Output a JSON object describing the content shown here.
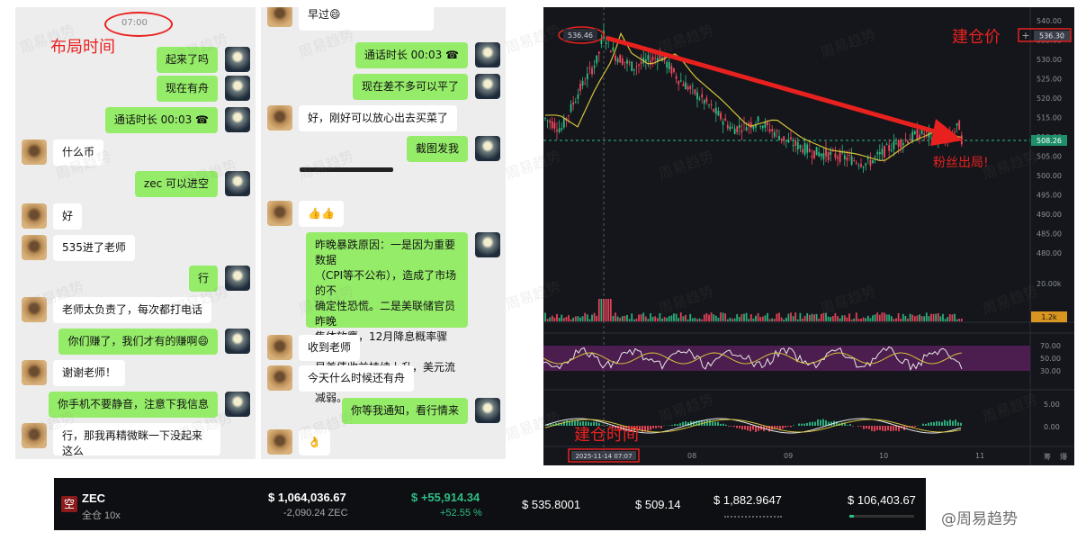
{
  "left_chat": {
    "time": "07:00",
    "annotation": "布局时间",
    "messages": [
      {
        "side": "self",
        "text": "起来了吗"
      },
      {
        "side": "self",
        "text": "现在有舟"
      },
      {
        "side": "self",
        "text": "通话时长 00:03 ☎"
      },
      {
        "side": "other",
        "text": "什么币"
      },
      {
        "side": "self",
        "text": "zec 可以进空"
      },
      {
        "side": "other",
        "text": "好"
      },
      {
        "side": "other",
        "text": "535进了老师"
      },
      {
        "side": "self",
        "text": "行"
      },
      {
        "side": "other",
        "text": "老师太负责了，每次都打电话"
      },
      {
        "side": "self",
        "text": "你们赚了，我们才有的赚啊😄"
      },
      {
        "side": "other",
        "text": "谢谢老师！"
      },
      {
        "side": "self",
        "text": "你手机不要静音，注意下我信息"
      },
      {
        "side": "other",
        "text": "行，那我再精微眯一下没起来这么\n早过😄"
      }
    ]
  },
  "right_chat": {
    "messages": [
      {
        "side": "other",
        "text": "早过😄"
      },
      {
        "side": "self",
        "text": "通话时长 00:03 ☎"
      },
      {
        "side": "self",
        "text": "现在差不多可以平了"
      },
      {
        "side": "other",
        "text": "好，刚好可以放心出去买菜了"
      },
      {
        "side": "self",
        "text": "截图发我"
      },
      {
        "side": "other",
        "text": "👍👍"
      },
      {
        "side": "self",
        "text": "昨晚暴跌原因：一是因为重要数据\n（CPI等不公布），造成了市场的不\n确定性恐慌。二是美联储官员昨晚\n集体放鹰，12月降息概率骤降。三\n是美债收益持续上升，美元流动性\n减弱。"
      },
      {
        "side": "other",
        "text": "收到老师"
      },
      {
        "side": "other",
        "text": "今天什么时候还有舟"
      },
      {
        "side": "self",
        "text": "你等我通知，看行情来"
      },
      {
        "side": "other",
        "text": "👌"
      }
    ]
  },
  "chart": {
    "entry_label": "建仓价",
    "entry_price": "536.30",
    "peak_label": "536.46",
    "current_price": "508.26",
    "volume_label": "1.2k",
    "exit_note": "粉丝出局!",
    "time_note": "建仓时间",
    "entry_time": "2025-11-14 07:07",
    "price_ticks": [
      "540.00",
      "535.00",
      "530.00",
      "525.00",
      "520.00",
      "515.00",
      "510.00",
      "505.00",
      "500.00",
      "495.00",
      "490.00",
      "485.00",
      "480.00"
    ],
    "volume_tick": "20.00k",
    "rsi_ticks": [
      "70.00",
      "50.00",
      "30.00"
    ],
    "macd_ticks": [
      "5.00",
      "0.00"
    ],
    "x_ticks": [
      "08",
      "09",
      "10",
      "11"
    ],
    "corner_labels": [
      "筹",
      "爆"
    ],
    "colors": {
      "up": "#2ebd85",
      "down": "#f6465d",
      "ma": "#d4c23a",
      "rsi_band": "#5a1f5c",
      "arrow": "#e8211f"
    }
  },
  "position": {
    "side_badge": "空",
    "symbol": "ZEC",
    "margin": "全仓 10x",
    "value": "$ 1,064,036.67",
    "size": "-2,090.24 ZEC",
    "pnl": "$ +55,914.34",
    "pnl_pct": "+52.55 %",
    "entry": "$ 535.8001",
    "mark": "$ 509.14",
    "liq": "$ 1,882.9647",
    "margin_value": "$ 106,403.67",
    "colors": {
      "badge": "#8b1a1a",
      "pnl": "#2ebd85"
    }
  },
  "watermark": "周易趋势",
  "brand": "@周易趋势"
}
